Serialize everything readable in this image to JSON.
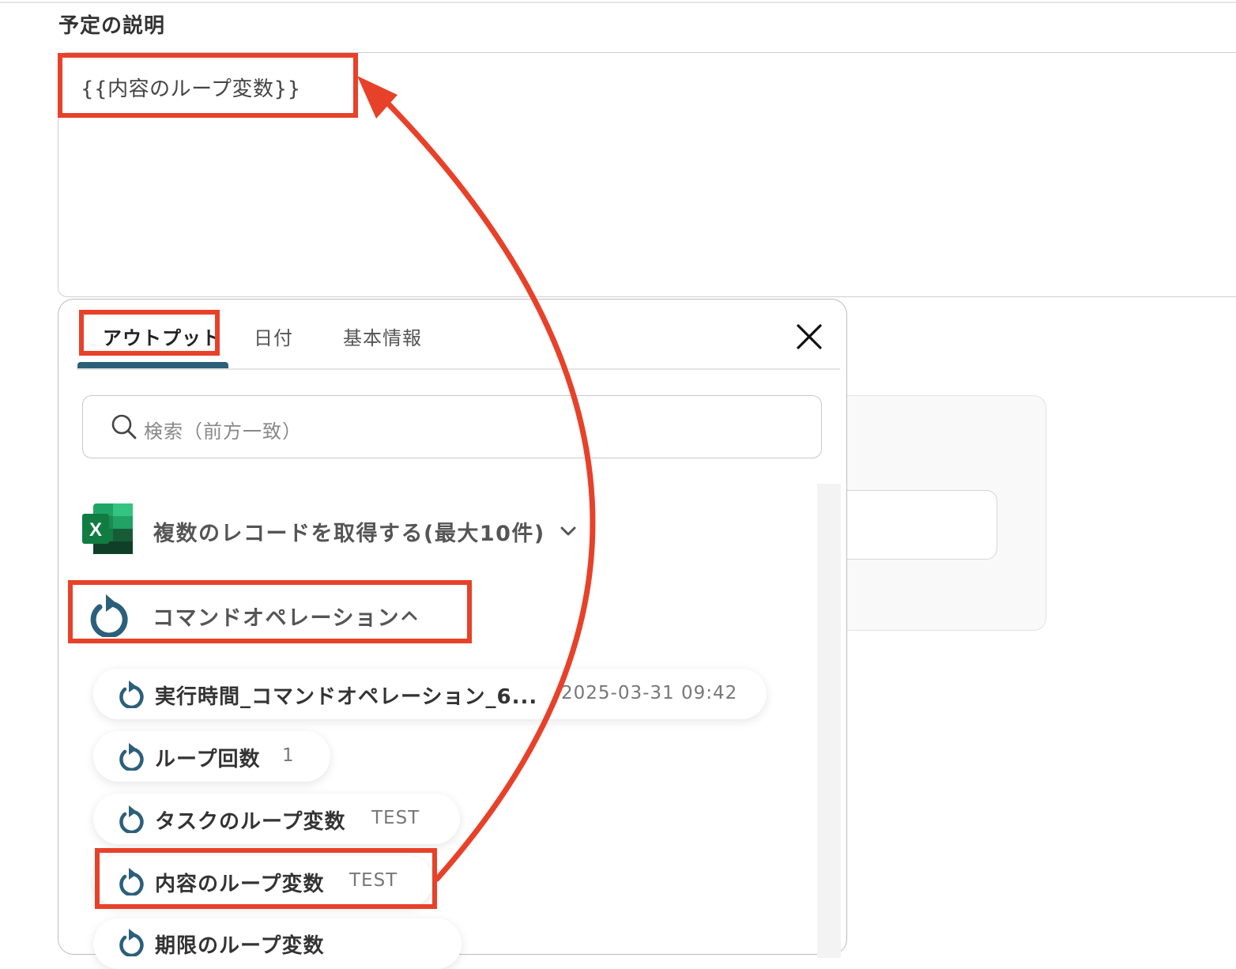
{
  "field": {
    "label": "予定の説明",
    "value": "{{内容のループ変数}}"
  },
  "popup": {
    "tabs": [
      {
        "label": "アウトプット",
        "active": true
      },
      {
        "label": "日付",
        "active": false
      },
      {
        "label": "基本情報",
        "active": false
      }
    ],
    "search": {
      "placeholder": "検索（前方一致）"
    },
    "sections": [
      {
        "title": "複数のレコードを取得する(最大10件)",
        "expanded": false,
        "icon": "excel-icon"
      },
      {
        "title": "コマンドオペレーション",
        "expanded": true,
        "icon": "loop-icon"
      }
    ],
    "items": [
      {
        "label": "実行時間_コマンドオペレーション_6...",
        "value": "2025-03-31 09:42"
      },
      {
        "label": "ループ回数",
        "value": "1"
      },
      {
        "label": "タスクのループ変数",
        "value": "TEST"
      },
      {
        "label": "内容のループ変数",
        "value": "TEST"
      },
      {
        "label": "期限のループ変数",
        "value": ""
      }
    ]
  },
  "colors": {
    "highlight": "#e8412a",
    "accent": "#2c5f7a",
    "excel_green": "#1e7145"
  }
}
